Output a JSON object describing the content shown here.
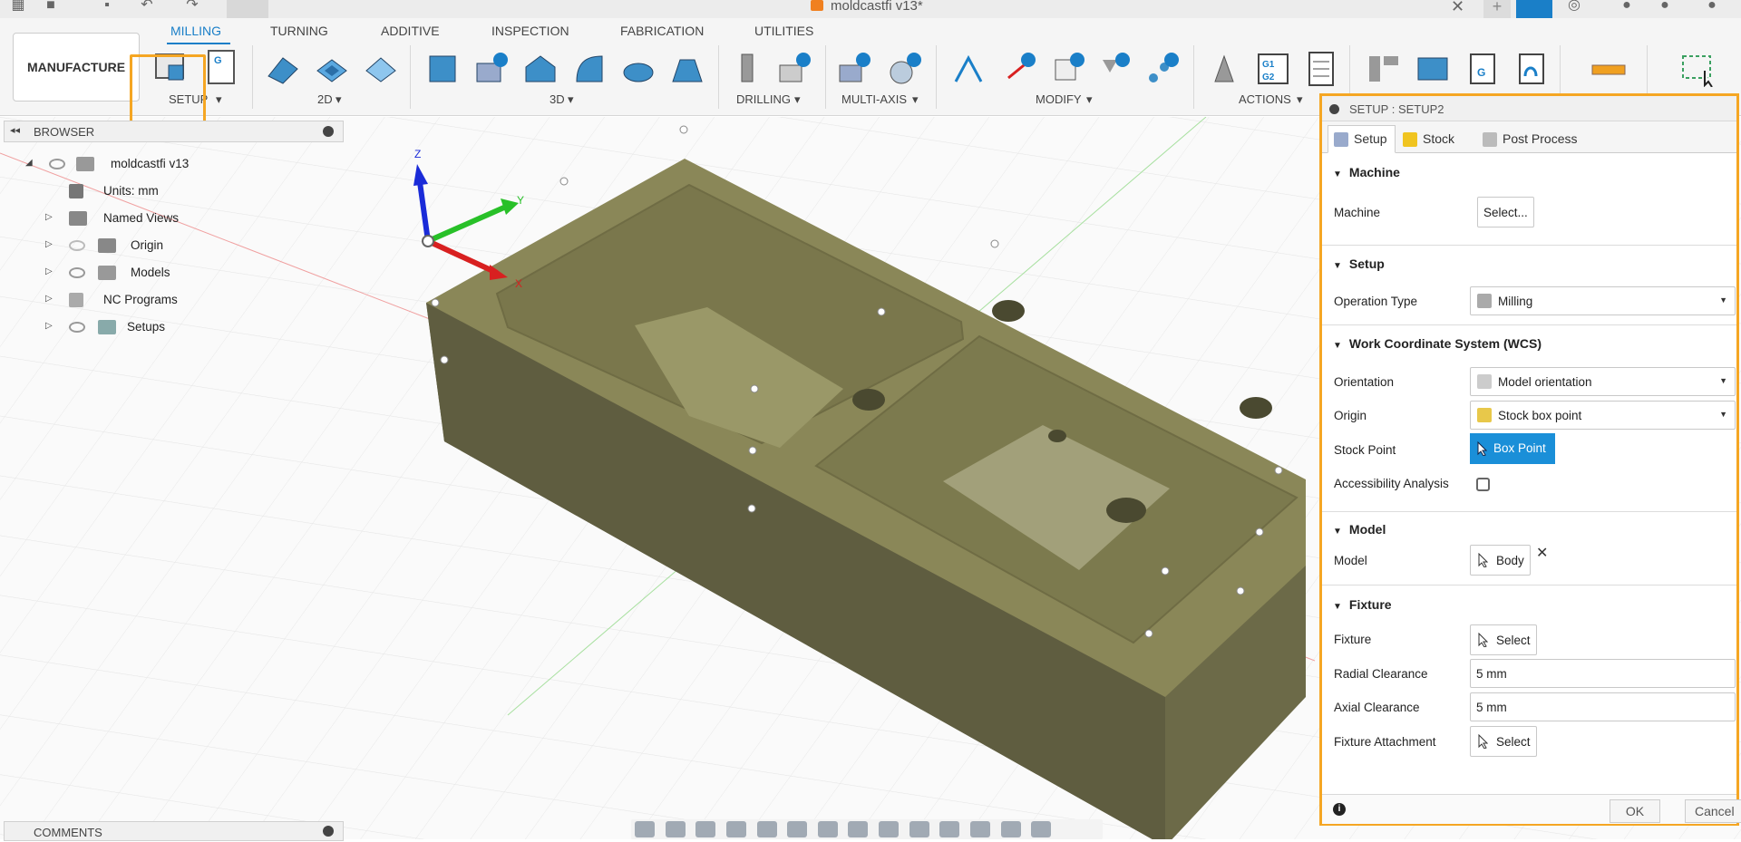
{
  "document": {
    "title": "moldcastfi v13*"
  },
  "workspace": {
    "label": "MANUFACTURE"
  },
  "ribbon": {
    "tabs": [
      {
        "label": "MILLING"
      },
      {
        "label": "TURNING"
      },
      {
        "label": "ADDITIVE"
      },
      {
        "label": "INSPECTION"
      },
      {
        "label": "FABRICATION"
      },
      {
        "label": "UTILITIES"
      }
    ],
    "groups": {
      "setup": "SETUP",
      "two_d": "2D",
      "three_d": "3D",
      "drilling": "DRILLING",
      "multi_axis": "MULTI-AXIS",
      "modify": "MODIFY",
      "actions": "ACTIONS"
    }
  },
  "browser": {
    "title": "BROWSER",
    "items": [
      {
        "label": "moldcastfi v13"
      },
      {
        "label": "Units: mm"
      },
      {
        "label": "Named Views"
      },
      {
        "label": "Origin"
      },
      {
        "label": "Models"
      },
      {
        "label": "NC Programs"
      },
      {
        "label": "Setups"
      }
    ]
  },
  "comments": {
    "title": "COMMENTS"
  },
  "axes": {
    "x": "X",
    "y": "Y",
    "z": "Z"
  },
  "panel": {
    "title": "SETUP : SETUP2",
    "tabs": [
      {
        "label": "Setup"
      },
      {
        "label": "Stock"
      },
      {
        "label": "Post Process"
      }
    ],
    "machine": {
      "heading": "Machine",
      "machine_label": "Machine",
      "select_btn": "Select..."
    },
    "setup": {
      "heading": "Setup",
      "op_type_label": "Operation Type",
      "op_type_value": "Milling"
    },
    "wcs": {
      "heading": "Work Coordinate System (WCS)",
      "orientation_label": "Orientation",
      "orientation_value": "Model orientation",
      "origin_label": "Origin",
      "origin_value": "Stock box point",
      "stock_point_label": "Stock Point",
      "stock_point_btn": "Box Point",
      "access_label": "Accessibility Analysis"
    },
    "model": {
      "heading": "Model",
      "model_label": "Model",
      "model_btn": "Body"
    },
    "fixture": {
      "heading": "Fixture",
      "fixture_label": "Fixture",
      "fixture_btn": "Select",
      "radial_label": "Radial Clearance",
      "radial_value": "5 mm",
      "axial_label": "Axial Clearance",
      "axial_value": "5 mm",
      "attach_label": "Fixture Attachment",
      "attach_btn": "Select"
    },
    "footer": {
      "ok": "OK",
      "cancel": "Cancel"
    }
  },
  "colors": {
    "accent": "#1a7fc8",
    "highlight": "#f5a623",
    "model_top": "#8a8758",
    "model_side": "#6c6a48"
  }
}
